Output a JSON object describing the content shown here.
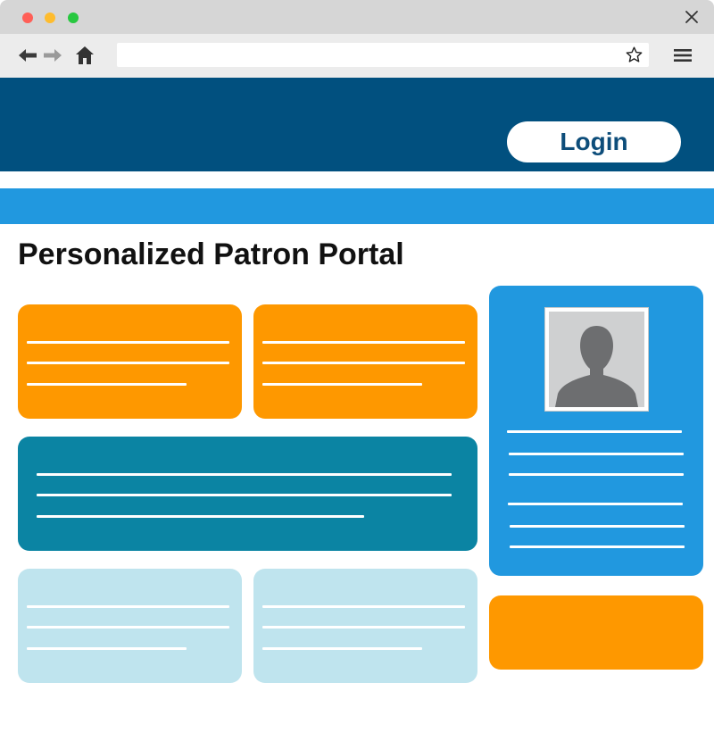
{
  "browser": {
    "window_controls": [
      "close-dot",
      "minimize-dot",
      "maximize-dot"
    ],
    "address_value": "",
    "icons": [
      "back-arrow-icon",
      "forward-arrow-icon",
      "home-icon",
      "bookmark-star-icon",
      "hamburger-menu-icon",
      "close-icon"
    ]
  },
  "header": {
    "login_label": "Login",
    "color": "#01507f"
  },
  "nav_strip": {
    "color": "#2198df"
  },
  "main": {
    "title": "Personalized Patron Portal"
  },
  "colors": {
    "orange": "#fe9800",
    "teal": "#0b84a3",
    "pale_blue": "#bfe4ee",
    "blue": "#2198df"
  },
  "profile": {
    "avatar_icon": "person-silhouette-icon"
  }
}
